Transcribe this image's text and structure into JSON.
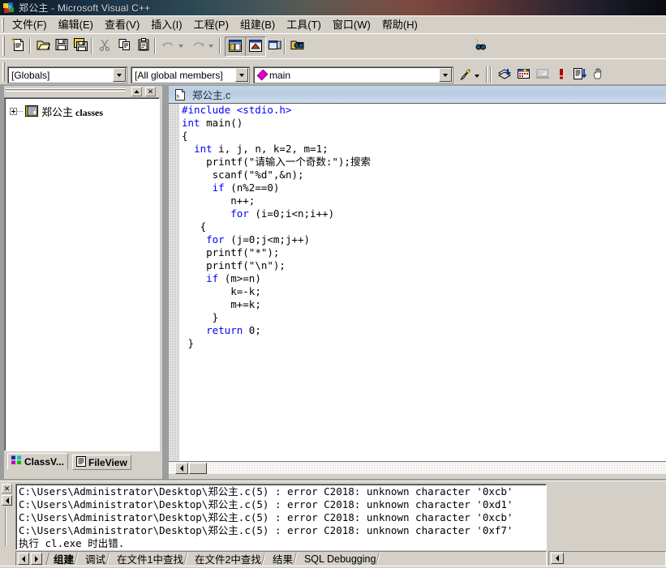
{
  "window": {
    "title": "郑公主 - Microsoft Visual C++",
    "icon": "visual-cpp-icon"
  },
  "menubar": {
    "items": [
      {
        "label": "文件(F)",
        "key": "F"
      },
      {
        "label": "编辑(E)",
        "key": "E"
      },
      {
        "label": "查看(V)",
        "key": "V"
      },
      {
        "label": "插入(I)",
        "key": "I"
      },
      {
        "label": "工程(P)",
        "key": "P"
      },
      {
        "label": "组建(B)",
        "key": "B"
      },
      {
        "label": "工具(T)",
        "key": "T"
      },
      {
        "label": "窗口(W)",
        "key": "W"
      },
      {
        "label": "帮助(H)",
        "key": "H"
      }
    ]
  },
  "standard_toolbar": {
    "buttons": [
      {
        "name": "new-text-file-icon",
        "tooltip": "新建文本文件"
      },
      {
        "name": "open-folder-icon",
        "tooltip": "打开"
      },
      {
        "name": "save-icon",
        "tooltip": "保存"
      },
      {
        "name": "save-all-icon",
        "tooltip": "全部保存"
      },
      {
        "name": "cut-scissors-icon",
        "tooltip": "剪切"
      },
      {
        "name": "copy-icon",
        "tooltip": "复制"
      },
      {
        "name": "paste-clipboard-icon",
        "tooltip": "粘贴"
      },
      {
        "name": "undo-icon",
        "tooltip": "撤消"
      },
      {
        "name": "redo-icon",
        "tooltip": "恢复"
      },
      {
        "name": "workspace-window-icon",
        "tooltip": "工作区"
      },
      {
        "name": "output-window-icon",
        "tooltip": "输出"
      },
      {
        "name": "window-list-icon",
        "tooltip": "窗口列表"
      },
      {
        "name": "find-in-files-binoculars-icon",
        "tooltip": "在文件中查找"
      },
      {
        "name": "help-binoculars-icon",
        "tooltip": "帮助搜索"
      }
    ],
    "find_box": {
      "value": "",
      "placeholder": ""
    }
  },
  "wizardbar": {
    "scope": "[Globals]",
    "members_filter": "[All global members]",
    "current_function": "main",
    "function_icon": "member-diamond-icon",
    "actions_icon": "wizard-wand-icon"
  },
  "build_toolbar": {
    "buttons": [
      {
        "name": "compile-icon",
        "tooltip": "编译"
      },
      {
        "name": "build-icon",
        "tooltip": "组建"
      },
      {
        "name": "build-execute-icon",
        "tooltip": "组建执行"
      },
      {
        "name": "stop-build-exclamation-icon",
        "tooltip": "执行程序"
      },
      {
        "name": "go-debug-icon",
        "tooltip": "执行"
      },
      {
        "name": "insert-breakpoint-hand-icon",
        "tooltip": "插入/删除断点"
      }
    ]
  },
  "workspace": {
    "caption_buttons": [
      {
        "name": "minimize-pane-button",
        "glyph": "▲"
      },
      {
        "name": "close-pane-button",
        "glyph": "✕"
      }
    ],
    "tree": {
      "root": {
        "label_cn": "郑公主",
        "label_en": " classes",
        "icon": "class-folder-icon",
        "expanded": false
      }
    },
    "tabs": [
      {
        "label": "ClassV...",
        "icon": "classview-icon",
        "active": true
      },
      {
        "label": "FileView",
        "icon": "fileview-icon",
        "active": false
      }
    ]
  },
  "editor": {
    "tab_title": "郑公主.c",
    "tab_icon": "c-source-file-icon",
    "code_lines": [
      {
        "indent": 0,
        "segments": [
          {
            "t": "#include <stdio.h>",
            "c": "kw"
          }
        ]
      },
      {
        "indent": 0,
        "segments": [
          {
            "t": "int",
            "c": "kw"
          },
          {
            "t": " main()",
            "c": ""
          }
        ]
      },
      {
        "indent": 0,
        "segments": [
          {
            "t": "{",
            "c": ""
          }
        ]
      },
      {
        "indent": 2,
        "segments": [
          {
            "t": "int",
            "c": "kw"
          },
          {
            "t": " i, j, n, k=2, m=1;",
            "c": ""
          }
        ]
      },
      {
        "indent": 4,
        "segments": [
          {
            "t": "printf(\"",
            "c": ""
          },
          {
            "t": "请输入一个奇数",
            "c": "cn"
          },
          {
            "t": ":\");",
            "c": ""
          },
          {
            "t": "搜索",
            "c": "cn"
          }
        ]
      },
      {
        "indent": 5,
        "segments": [
          {
            "t": "scanf(\"%d\",&n);",
            "c": ""
          }
        ]
      },
      {
        "indent": 5,
        "segments": [
          {
            "t": "if",
            "c": "kw"
          },
          {
            "t": " (n%2==0)",
            "c": ""
          }
        ]
      },
      {
        "indent": 8,
        "segments": [
          {
            "t": "n++;",
            "c": ""
          }
        ]
      },
      {
        "indent": 8,
        "segments": [
          {
            "t": "for",
            "c": "kw"
          },
          {
            "t": " (i=0;i<n;i++)",
            "c": ""
          }
        ]
      },
      {
        "indent": 3,
        "segments": [
          {
            "t": "{",
            "c": ""
          }
        ]
      },
      {
        "indent": 4,
        "segments": [
          {
            "t": "for",
            "c": "kw"
          },
          {
            "t": " (j=0;j<m;j++)",
            "c": ""
          }
        ]
      },
      {
        "indent": 4,
        "segments": [
          {
            "t": "printf(\"*\");",
            "c": ""
          }
        ]
      },
      {
        "indent": 4,
        "segments": [
          {
            "t": "printf(\"\\n\");",
            "c": ""
          }
        ]
      },
      {
        "indent": 4,
        "segments": [
          {
            "t": "if",
            "c": "kw"
          },
          {
            "t": " (m>=n)",
            "c": ""
          }
        ]
      },
      {
        "indent": 8,
        "segments": [
          {
            "t": "k=-k;",
            "c": ""
          }
        ]
      },
      {
        "indent": 8,
        "segments": [
          {
            "t": "m+=k;",
            "c": ""
          }
        ]
      },
      {
        "indent": 5,
        "segments": [
          {
            "t": "}",
            "c": ""
          }
        ]
      },
      {
        "indent": 4,
        "segments": [
          {
            "t": "return",
            "c": "kw"
          },
          {
            "t": " 0;",
            "c": ""
          }
        ]
      },
      {
        "indent": 1,
        "segments": [
          {
            "t": "}",
            "c": ""
          }
        ]
      }
    ],
    "scrollbar": {
      "h_left_arrow": "◀",
      "h_right_arrow": "▶"
    }
  },
  "output": {
    "lines": [
      "C:\\Users\\Administrator\\Desktop\\郑公主.c(5) : error C2018: unknown character '0xcb'",
      "C:\\Users\\Administrator\\Desktop\\郑公主.c(5) : error C2018: unknown character '0xd1'",
      "C:\\Users\\Administrator\\Desktop\\郑公主.c(5) : error C2018: unknown character '0xcb'",
      "C:\\Users\\Administrator\\Desktop\\郑公主.c(5) : error C2018: unknown character '0xf7'",
      "执行 cl.exe 时出错."
    ],
    "close_glyph": "✕",
    "tabs": [
      {
        "label": "组建",
        "active": true
      },
      {
        "label": "调试",
        "active": false
      },
      {
        "label": "在文件1中查找",
        "active": false
      },
      {
        "label": "在文件2中查找",
        "active": false
      },
      {
        "label": "结果",
        "active": false
      },
      {
        "label": "SQL Debugging",
        "active": false
      }
    ]
  },
  "colors": {
    "keyword_blue": "#0000ff",
    "face": "#d4d0c8",
    "mdi_background": "#9a9e9e",
    "editor_bg": "#ffffff"
  }
}
